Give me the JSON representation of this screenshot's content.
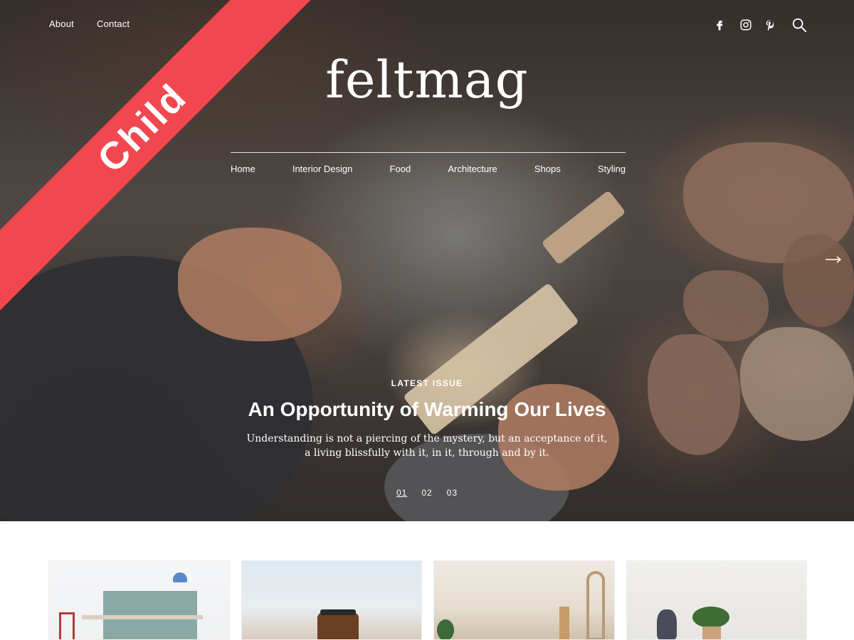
{
  "top_nav": {
    "about": "About",
    "contact": "Contact"
  },
  "social_icons": [
    "facebook-icon",
    "instagram-icon",
    "pinterest-icon",
    "search-icon"
  ],
  "logo": "feltmag",
  "main_nav": [
    "Home",
    "Interior Design",
    "Food",
    "Architecture",
    "Shops",
    "Styling"
  ],
  "ribbon": "Child",
  "hero": {
    "kicker": "LATEST ISSUE",
    "title": "An Opportunity of Warming Our Lives",
    "excerpt_line1": "Understanding is not a piercing of the mystery, but an acceptance of it,",
    "excerpt_line2": "a living blissfully with it, in it, through and by it.",
    "slides": [
      "01",
      "02",
      "03"
    ],
    "active_slide": "01"
  },
  "colors": {
    "ribbon": "#f2474f",
    "text_on_hero": "#ffffff"
  }
}
